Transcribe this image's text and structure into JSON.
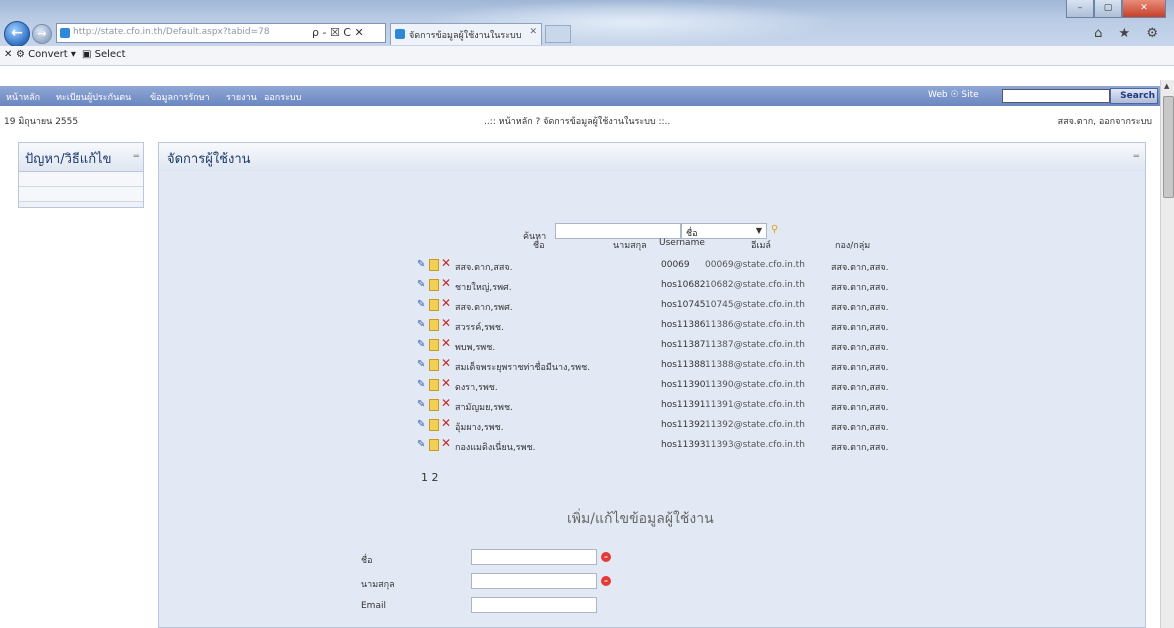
{
  "browser": {
    "address": "http://state.cfo.in.th/Default.aspx?tabid=78",
    "address_domain": "cfo.in.th",
    "address_tools": "ρ - ☒ C ✕",
    "tab_title": "จัดการข้อมูลผู้ใช้งานในระบบ",
    "toolbar": {
      "convert_label": "Convert",
      "select_label": "Select"
    },
    "right_icons": "⌂ ★ ⚙"
  },
  "site": {
    "menu": [
      "หน้าหลัก",
      "ทะเบียนผู้ประกันตน",
      "ข้อมูลการรักษา",
      "รายงาน",
      "ออกระบบ"
    ],
    "web_label": "Web ☉ Site",
    "search_button": "Search",
    "date": "19 มิถุนายน 2555",
    "breadcrumb": "..:: หน้าหลัก ? จัดการข้อมูลผู้ใช้งานในระบบ ::..",
    "user": "สสจ.ตาก, ออกจากระบบ"
  },
  "sidebar": {
    "title": "ปัญหา/วิธีแก้ไข"
  },
  "panel": {
    "title": "จัดการผู้ใช้งาน",
    "search_label": "ค้นหา",
    "search_field_value": "ชื่อ",
    "columns": {
      "name": "ชื่อ",
      "surname": "นามสกุล",
      "username": "Username",
      "email": "อีเมล์",
      "division": "กอง/กลุ่ม"
    },
    "rows": [
      {
        "name": "สสจ.ตาก,สสจ.",
        "username": "00069",
        "email": "00069@state.cfo.in.th",
        "division": "สสจ.ตาก,สสจ."
      },
      {
        "name": "ชายใหญ่,รพศ.",
        "username": "hos10682",
        "email": "10682@state.cfo.in.th",
        "division": "สสจ.ตาก,สสจ."
      },
      {
        "name": "สสจ.ตาก,รพศ.",
        "username": "hos10745",
        "email": "10745@state.cfo.in.th",
        "division": "สสจ.ตาก,สสจ."
      },
      {
        "name": "สวรรค์,รพช.",
        "username": "hos11386",
        "email": "11386@state.cfo.in.th",
        "division": "สสจ.ตาก,สสจ."
      },
      {
        "name": "พบพ,รพช.",
        "username": "hos11387",
        "email": "11387@state.cfo.in.th",
        "division": "สสจ.ตาก,สสจ."
      },
      {
        "name": "สมเด็จพระยุพราชท่าชื่อมีนาง,รพช.",
        "username": "hos11388",
        "email": "11388@state.cfo.in.th",
        "division": "สสจ.ตาก,สสจ."
      },
      {
        "name": "ดงรา,รพช.",
        "username": "hos11390",
        "email": "11390@state.cfo.in.th",
        "division": "สสจ.ตาก,สสจ."
      },
      {
        "name": "สามัญมย,รพช.",
        "username": "hos11391",
        "email": "11391@state.cfo.in.th",
        "division": "สสจ.ตาก,สสจ."
      },
      {
        "name": "อุ้มผาง,รพช.",
        "username": "hos11392",
        "email": "11392@state.cfo.in.th",
        "division": "สสจ.ตาก,สสจ."
      },
      {
        "name": "กองแมดิงเนี่ยน,รพช.",
        "username": "hos11393",
        "email": "11393@state.cfo.in.th",
        "division": "สสจ.ตาก,สสจ."
      }
    ],
    "pager": "1 2",
    "form": {
      "title": "เพิ่ม/แก้ไขข้อมูลผู้ใช้งาน",
      "name_label": "ชื่อ",
      "surname_label": "นามสกุล",
      "email_label": "Email"
    }
  }
}
